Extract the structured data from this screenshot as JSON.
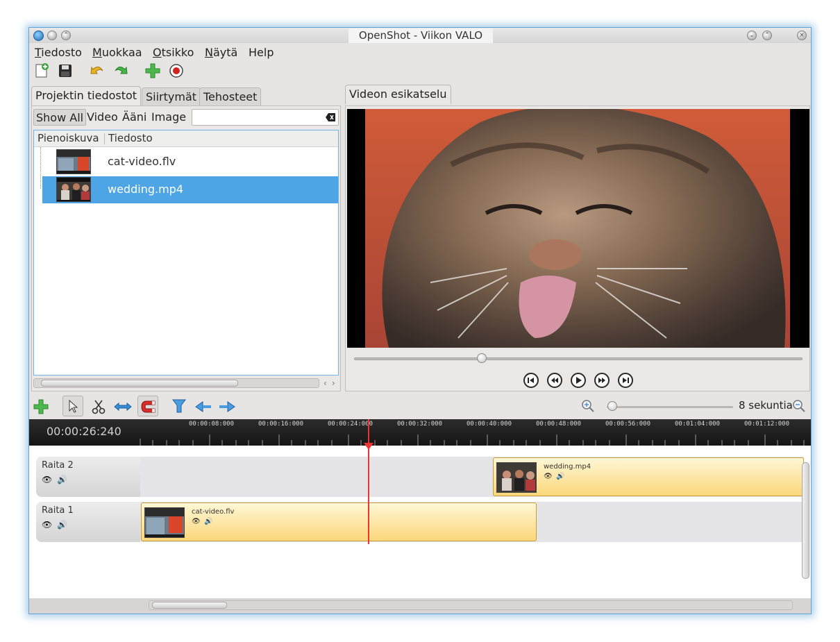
{
  "window": {
    "title": "OpenShot - Viikon VALO"
  },
  "menu": {
    "items": [
      {
        "underline": "T",
        "rest": "iedosto"
      },
      {
        "underline": "M",
        "rest": "uokkaa"
      },
      {
        "underline": "O",
        "rest": "tsikko"
      },
      {
        "underline": "N",
        "rest": "äytä"
      },
      {
        "underline": "",
        "rest": "Help"
      }
    ]
  },
  "left_tabs": [
    "Projektin tiedostot",
    "Siirtymät",
    "Tehosteet"
  ],
  "filters": [
    "Show All",
    "Video",
    "Ääni",
    "Image"
  ],
  "file_list": {
    "columns": [
      "Pienoiskuva",
      "Tiedosto"
    ],
    "rows": [
      {
        "name": "cat-video.flv",
        "selected": false
      },
      {
        "name": "wedding.mp4",
        "selected": true
      }
    ]
  },
  "preview_tab": "Videon esikatselu",
  "timeline": {
    "zoom_label": "8 sekuntia",
    "current_time": "00:00:26:240",
    "ticks": [
      "00:00:08:000",
      "00:00:16:000",
      "00:00:24:000",
      "00:00:32:000",
      "00:00:40:000",
      "00:00:48:000",
      "00:00:56:000",
      "00:01:04:000",
      "00:01:12:000"
    ],
    "tracks": [
      {
        "name": "Raita 2",
        "clips": [
          {
            "name": "wedding.mp4"
          }
        ]
      },
      {
        "name": "Raita 1",
        "clips": [
          {
            "name": "cat-video.flv"
          }
        ]
      }
    ]
  },
  "colors": {
    "selection": "#4da5e6",
    "clip": "#fbd77a",
    "playhead": "#e33333"
  },
  "icons": [
    "new-project-icon",
    "save-icon",
    "undo-icon",
    "redo-icon",
    "add-icon",
    "record-icon",
    "pointer-icon",
    "razor-icon",
    "resize-icon",
    "snap-magnet-icon",
    "marker-icon",
    "prev-marker-icon",
    "next-marker-icon",
    "zoom-in-icon",
    "zoom-out-icon",
    "play-icon",
    "rewind-icon",
    "fast-forward-icon",
    "jump-start-icon",
    "jump-end-icon",
    "eye-icon",
    "speaker-icon"
  ]
}
